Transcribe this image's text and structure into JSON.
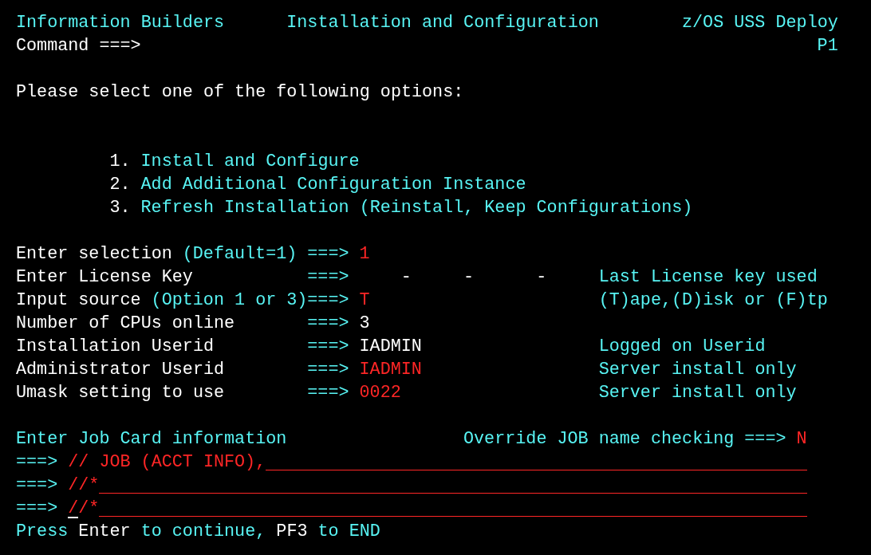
{
  "header": {
    "product": "Information Builders",
    "title": "Installation and Configuration",
    "environment": "z/OS USS Deploy",
    "command_label": "Command ===>",
    "panel_id": "P1"
  },
  "prompt": "Please select one of the following options:",
  "options": [
    {
      "number": "1.",
      "label": "Install and Configure"
    },
    {
      "number": "2.",
      "label": "Add Additional Configuration Instance"
    },
    {
      "number": "3.",
      "label": "Refresh Installation (Reinstall, Keep Configurations)"
    }
  ],
  "fields": [
    {
      "label": "Enter selection",
      "hint": "(Default=1)",
      "arrow": "===>",
      "kind": "input",
      "value": "1"
    },
    {
      "label": "Enter License Key",
      "arrow": "===>",
      "kind": "license",
      "separators": [
        "-",
        "-",
        "-"
      ],
      "note": "Last License key used"
    },
    {
      "label": "Input source",
      "hint": "(Option 1 or 3)",
      "arrow": "===>",
      "kind": "input",
      "value": "T",
      "note": "(T)ape,(D)isk or (F)tp"
    },
    {
      "label": "Number of CPUs online",
      "arrow": "===>",
      "kind": "display",
      "value": "3"
    },
    {
      "label": "Installation Userid",
      "arrow": "===>",
      "kind": "display",
      "value": "IADMIN",
      "note": "Logged on Userid"
    },
    {
      "label": "Administrator Userid",
      "arrow": "===>",
      "kind": "input",
      "value": "IADMIN",
      "note": "Server install only"
    },
    {
      "label": "Umask setting to use",
      "arrow": "===>",
      "kind": "input",
      "value": "0022",
      "note": "Server install only"
    }
  ],
  "job_card": {
    "heading": "Enter Job Card information",
    "override": {
      "label": "Override JOB name checking",
      "arrow": "===>",
      "value": "N"
    },
    "lines": [
      {
        "arrow": "===>",
        "value": "// JOB (ACCT INFO),",
        "cursor": false
      },
      {
        "arrow": "===>",
        "value": "//*",
        "cursor": false
      },
      {
        "arrow": "===>",
        "value": "//*",
        "cursor": true
      }
    ]
  },
  "footer": "Press **Enter** to continue, **PF3** to END"
}
